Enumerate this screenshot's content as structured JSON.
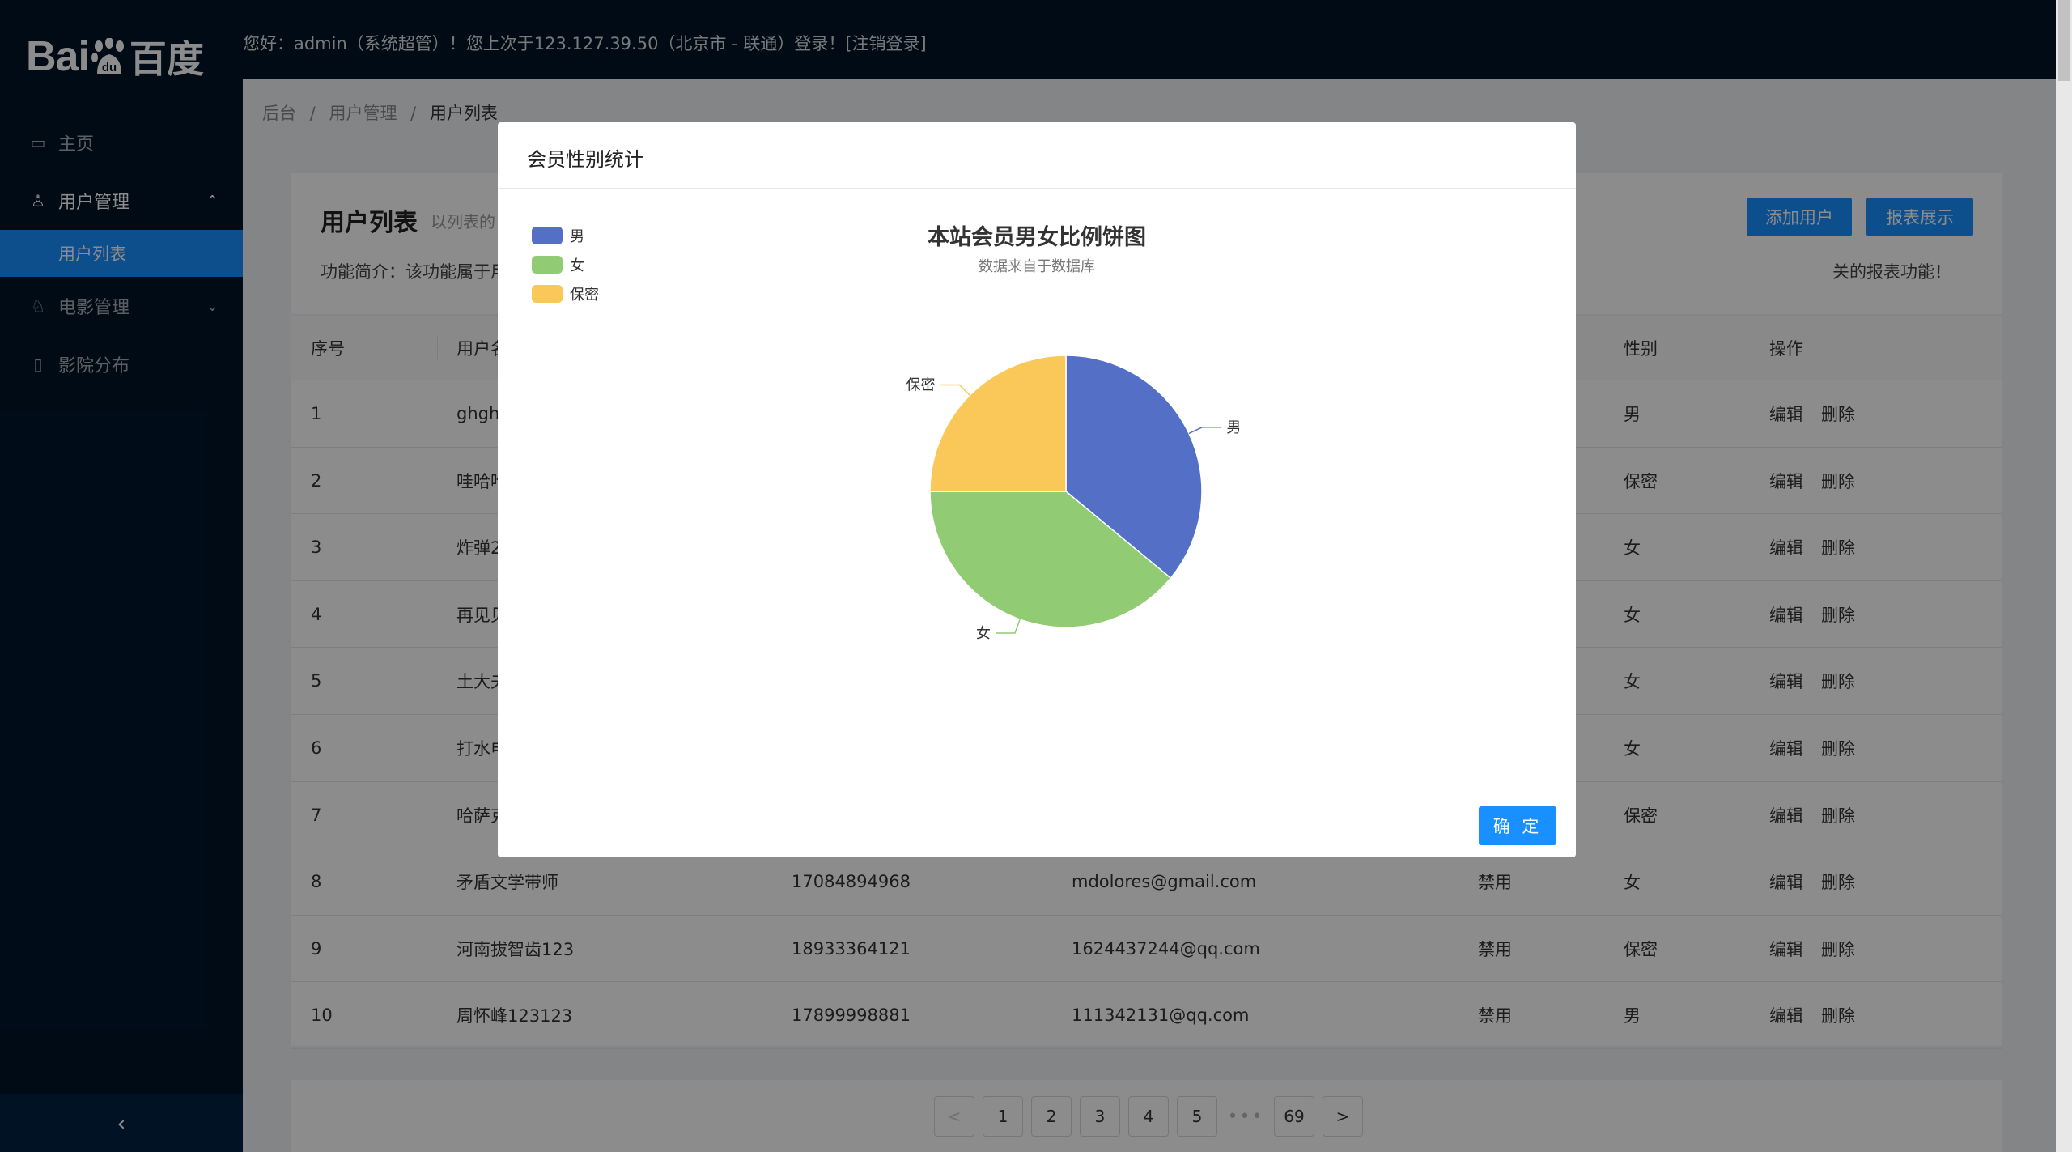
{
  "brand": {
    "logo_en": "Bai",
    "logo_mid": "du",
    "logo_cn": "百度"
  },
  "sidebar": {
    "items": [
      {
        "label": "主页",
        "icon": "monitor-icon"
      },
      {
        "label": "用户管理",
        "icon": "user-icon",
        "open": true,
        "children": [
          {
            "label": "用户列表",
            "active": true
          }
        ]
      },
      {
        "label": "电影管理",
        "icon": "film-user-icon"
      },
      {
        "label": "影院分布",
        "icon": "file-icon"
      }
    ],
    "collapse_glyph": "‹"
  },
  "header": {
    "greeting": "您好：admin（系统超管）！您上次于123.127.39.50（北京市 - 联通）登录！[注销登录]"
  },
  "breadcrumb": {
    "items": [
      "后台",
      "用户管理",
      "用户列表"
    ],
    "separator": "/"
  },
  "page_head": {
    "title": "用户列表",
    "subtitle": "以列表的",
    "desc_left": "功能简介：该功能属于用",
    "desc_right": "关的报表功能！",
    "add_button": "添加用户",
    "report_button": "报表展示"
  },
  "table": {
    "columns": [
      "序号",
      "用户名",
      "",
      "",
      "",
      "性别",
      "操作"
    ],
    "edit_label": "编辑",
    "delete_label": "删除",
    "rows": [
      {
        "no": "1",
        "name": "ghgh",
        "phone": "",
        "email": "",
        "status": "",
        "gender": "男"
      },
      {
        "no": "2",
        "name": "哇哈哈",
        "phone": "",
        "email": "",
        "status": "",
        "gender": "保密"
      },
      {
        "no": "3",
        "name": "炸弹2",
        "phone": "",
        "email": "",
        "status": "",
        "gender": "女"
      },
      {
        "no": "4",
        "name": "再见见",
        "phone": "",
        "email": "",
        "status": "",
        "gender": "女"
      },
      {
        "no": "5",
        "name": "土大夫",
        "phone": "",
        "email": "",
        "status": "",
        "gender": "女"
      },
      {
        "no": "6",
        "name": "打水电",
        "phone": "",
        "email": "",
        "status": "",
        "gender": "女"
      },
      {
        "no": "7",
        "name": "哈萨克",
        "phone": "",
        "email": "",
        "status": "",
        "gender": "保密"
      },
      {
        "no": "8",
        "name": "矛盾文学带师",
        "phone": "17084894968",
        "email": "mdolores@gmail.com",
        "status": "禁用",
        "gender": "女"
      },
      {
        "no": "9",
        "name": "河南拔智齿123",
        "phone": "18933364121",
        "email": "1624437244@qq.com",
        "status": "禁用",
        "gender": "保密"
      },
      {
        "no": "10",
        "name": "周怀峰123123",
        "phone": "17899998881",
        "email": "111342131@qq.com",
        "status": "禁用",
        "gender": "男"
      }
    ]
  },
  "pagination": {
    "prev": "<",
    "next": ">",
    "pages": [
      "1",
      "2",
      "3",
      "4",
      "5"
    ],
    "ellipsis": "•••",
    "last": "69"
  },
  "modal": {
    "title": "会员性别统计",
    "ok_button": "确 定"
  },
  "chart_data": {
    "type": "pie",
    "title": "本站会员男女比例饼图",
    "subtitle": "数据来自于数据库",
    "legend_position": "top-left",
    "categories": [
      "男",
      "女",
      "保密"
    ],
    "values": [
      36,
      39,
      25
    ],
    "colors": [
      "#5470c6",
      "#91cc75",
      "#fac858"
    ]
  }
}
